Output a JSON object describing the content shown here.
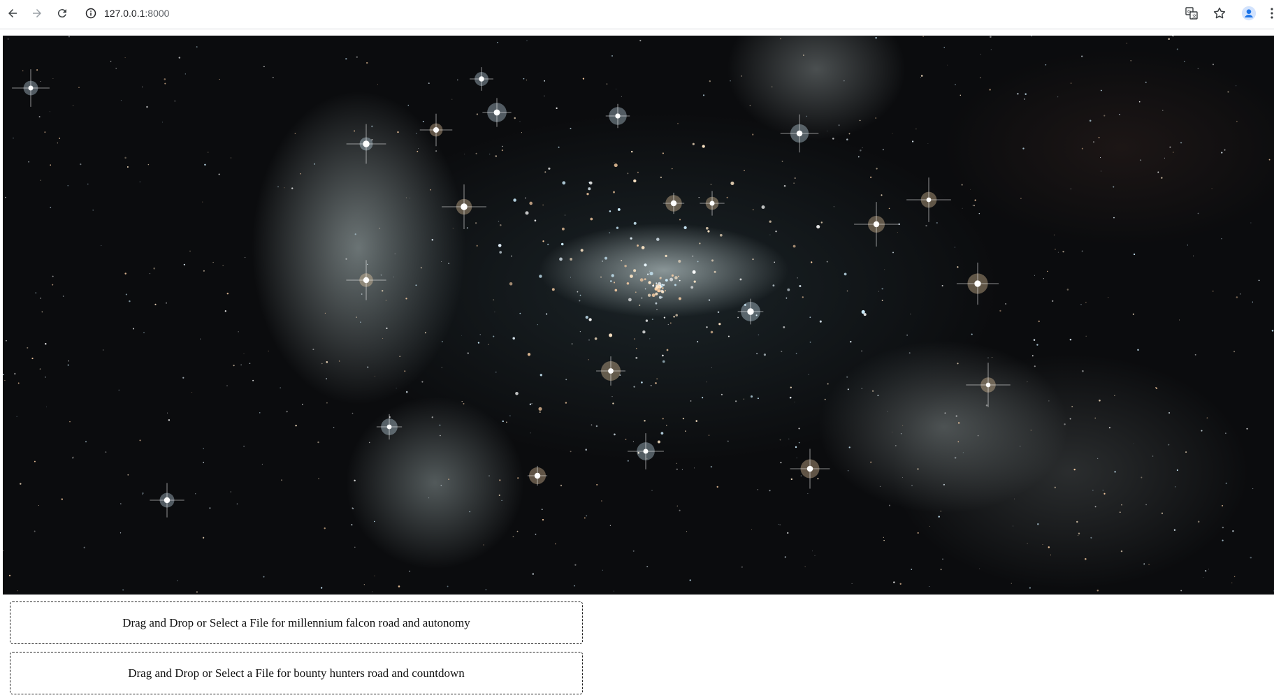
{
  "browser": {
    "url_host": "127.0.0.1",
    "url_port": ":8000",
    "icons": [
      "back-icon",
      "forward-icon",
      "reload-icon",
      "site-info-icon",
      "translate-icon",
      "bookmark-star-icon",
      "profile-avatar-icon"
    ]
  },
  "hero": {
    "image": "starfield-nebula-image"
  },
  "dropzones": [
    {
      "label": "Drag and Drop or Select a File for millennium falcon road and autonomy"
    },
    {
      "label": "Drag and Drop or Select a File for bounty hunters road and countdown"
    }
  ],
  "colors": {
    "space_background": "#0b0c0e",
    "nebula": "#c8d4d4",
    "profile_blue": "#1a73e8"
  }
}
